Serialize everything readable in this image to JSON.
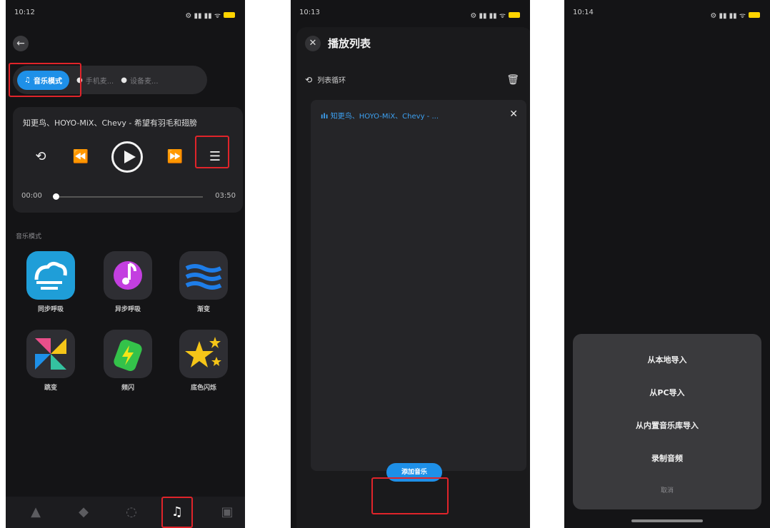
{
  "phone1": {
    "status": {
      "time": "10:12",
      "dots": "• ···",
      "signal": "⚙ ▮▮ ▮▮ ᯤ"
    },
    "back_icon": "←",
    "modes": [
      {
        "label": "音乐模式",
        "icon": "music-note-icon",
        "active": true
      },
      {
        "label": "手机麦...",
        "icon": "mic-icon",
        "active": false
      },
      {
        "label": "设备麦...",
        "icon": "mic-icon",
        "active": false
      }
    ],
    "song_title": "知更鸟、HOYO-MiX、Chevy - 希望有羽毛和翅膀",
    "time_current": "00:00",
    "time_total": "03:50",
    "progress": 0.0,
    "section_label": "音乐模式",
    "effects": [
      {
        "label": "同步呼吸",
        "icon": "wind-icon",
        "color": "#2ea8e0"
      },
      {
        "label": "异步呼吸",
        "icon": "music-note-icon",
        "color": "#c33fe0"
      },
      {
        "label": "渐变",
        "icon": "waves-icon",
        "color": "#1e7de8"
      },
      {
        "label": "跳变",
        "icon": "pinwheel-icon",
        "color": "#e94f8a"
      },
      {
        "label": "频闪",
        "icon": "battery-bolt-icon",
        "color": "#34c24a"
      },
      {
        "label": "底色闪烁",
        "icon": "stars-icon",
        "color": "#f5c518"
      }
    ]
  },
  "phone2": {
    "status": {
      "time": "10:13",
      "dots": "• ···",
      "signal": "⚙ ▮▮ ▮▮ ᯤ"
    },
    "close_icon": "✕",
    "title": "播放列表",
    "loop_label": "列表循环",
    "list_items": [
      {
        "title": "知更鸟、HOYO-MiX、Chevy - ..."
      }
    ],
    "item_close": "✕",
    "add_button": "添加音乐"
  },
  "phone3": {
    "status": {
      "time": "10:14",
      "dots": "• ···",
      "signal": "⚙ ▮▮ ▮▮ ᯤ"
    },
    "options": [
      "从本地导入",
      "从PC导入",
      "从内置音乐库导入",
      "录制音频"
    ],
    "cancel": "取消"
  }
}
